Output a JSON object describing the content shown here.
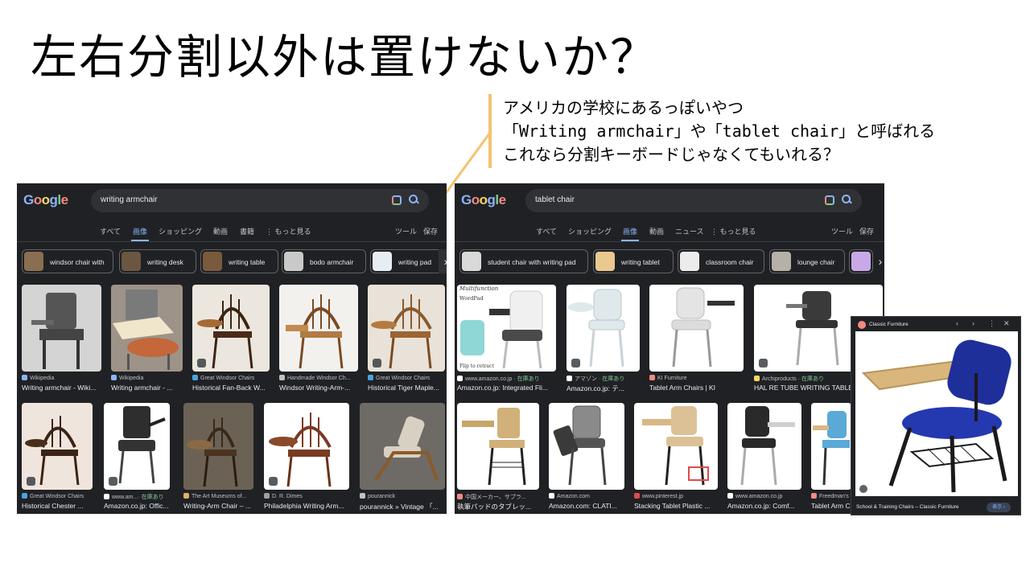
{
  "slide": {
    "title": "左右分割以外は置けないか？",
    "note_lines": [
      "アメリカの学校にあるっぽいやつ",
      "「Writing armchair」や「tablet chair」と呼ばれる",
      "これなら分割キーボードじゃなくてもいれる？"
    ],
    "accent_color": "#f5c270"
  },
  "left": {
    "logo": [
      "G",
      "o",
      "o",
      "g",
      "l",
      "e"
    ],
    "query": "writing armchair",
    "tabs": [
      "すべて",
      "画像",
      "ショッピング",
      "動画",
      "書籍",
      "⋮ もっと見る",
      "ツール",
      "保存"
    ],
    "active_tab": "画像",
    "chips": [
      "windsor chair with",
      "writing desk",
      "writing table",
      "bodo armchair",
      "writing pad"
    ],
    "row1": [
      {
        "source": "Wikipedia",
        "title": "Writing armchair - Wiki..."
      },
      {
        "source": "Wikipedia",
        "title": "Writing armchair - ..."
      },
      {
        "source": "Great Windsor Chairs",
        "title": "Historical Fan-Back W..."
      },
      {
        "source": "Handmade Windsor Ch...",
        "title": "Windsor Writing-Arm-..."
      },
      {
        "source": "Great Windsor Chairs",
        "title": "Historical Tiger Maple..."
      }
    ],
    "row2": [
      {
        "source": "Great Windsor Chairs",
        "title": "Historical Chester ..."
      },
      {
        "source": "www.am...",
        "stock": "· 在庫あり",
        "title": "Amazon.co.jp: Offic..."
      },
      {
        "source": "The Art Museums of...",
        "title": "Writing-Arm Chair – ..."
      },
      {
        "source": "D. R. Dimes",
        "title": "Philadelphia Writing Arm..."
      },
      {
        "source": "pourannick",
        "title": "pourannick » Vintage 「..."
      }
    ]
  },
  "right": {
    "logo": [
      "G",
      "o",
      "o",
      "g",
      "l",
      "e"
    ],
    "query": "tablet chair",
    "tabs": [
      "すべて",
      "ショッピング",
      "画像",
      "動画",
      "ニュース",
      "⋮ もっと見る",
      "ツール",
      "保存"
    ],
    "active_tab": "画像",
    "chips": [
      "student chair with writing pad",
      "writing tablet",
      "classroom chair",
      "lounge chair"
    ],
    "image_text": [
      "Multifunction",
      "WordPad",
      "Flip to retract"
    ],
    "row1": [
      {
        "source": "www.amazon.co.jp",
        "stock": "· 在庫あり",
        "title": "Amazon.co.jp: Integrated Fli..."
      },
      {
        "source": "アマゾン",
        "stock": "· 在庫あり",
        "title": "Amazon.co.jp: テ..."
      },
      {
        "source": "KI Furniture",
        "title": "Tablet Arm Chairs | KI"
      },
      {
        "source": "Archiproducts",
        "stock": "· 在庫あり",
        "title": "HAL RE TUBE WRITING TABLET"
      }
    ],
    "row2": [
      {
        "source": "中国メーカー、サプラ...",
        "title": "執筆パッドのタブレッ..."
      },
      {
        "source": "Amazon.com",
        "title": "Amazon.com: CLATI..."
      },
      {
        "source": "www.pinterest.jp",
        "title": "Stacking Tablet Plastic ..."
      },
      {
        "source": "www.amazon.co.jp",
        "title": "Amazon.co.jp: Comf..."
      },
      {
        "source": "Freedman's",
        "title": "Tablet Arm C..."
      }
    ]
  },
  "preview": {
    "source": "Classic Furniture",
    "controls": [
      "‹",
      "›",
      "⋮",
      "✕"
    ],
    "caption": "School & Training Chairs – Classic Furniture",
    "visit_button": "表示 ›"
  }
}
